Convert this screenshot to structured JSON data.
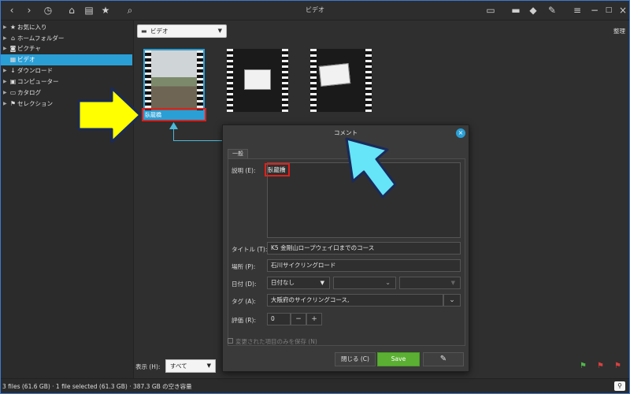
{
  "window": {
    "title": "ビデオ"
  },
  "sidebar": {
    "items": [
      {
        "label": "お気に入り",
        "icon": "star-icon",
        "selected": false
      },
      {
        "label": "ホームフォルダー",
        "icon": "home-icon",
        "selected": false
      },
      {
        "label": "ピクチャ",
        "icon": "camera-icon",
        "selected": false
      },
      {
        "label": "ビデオ",
        "icon": "film-icon",
        "selected": true
      },
      {
        "label": "ダウンロード",
        "icon": "download-icon",
        "selected": false
      },
      {
        "label": "コンピューター",
        "icon": "computer-icon",
        "selected": false
      },
      {
        "label": "カタログ",
        "icon": "catalog-icon",
        "selected": false
      },
      {
        "label": "セレクション",
        "icon": "flag-icon",
        "selected": false
      }
    ]
  },
  "toolbar": {
    "path": "ビデオ",
    "organize": "整理"
  },
  "thumbnails": [
    {
      "caption": "臥龍橋",
      "selected": true
    },
    {
      "caption": "",
      "selected": false
    },
    {
      "caption": "",
      "selected": false
    }
  ],
  "bottom": {
    "show_label": "表示 (H):",
    "show_value": "すべて"
  },
  "status": {
    "text": "3 files (61.6 GB)  ·  1 file selected (61.3 GB)  ·  387.3 GB の空き容量"
  },
  "dialog": {
    "title": "コメント",
    "tab": "一般",
    "description_label": "説明 (E):",
    "description_value": "臥龍橋",
    "title_label": "タイトル (T):",
    "title_value": "K5 金剛山ロープウェイ口までのコース",
    "place_label": "場所 (P):",
    "place_value": "石川サイクリングロード",
    "date_label": "日付 (D):",
    "date_value": "日付なし",
    "tag_label": "タグ (A):",
    "tag_value": "大阪府のサイクリングコース,",
    "rating_label": "評価 (R):",
    "rating_value": "0",
    "minus": "−",
    "plus": "+",
    "save_changed_only": "変更された項目のみを保存 (N)",
    "close_button": "閉じる (C)",
    "save_button": "Save"
  },
  "colors": {
    "accent": "#2a9fd6",
    "highlight_red": "#e0201b",
    "save_green": "#5bb033",
    "callout_yellow": "#ffff00",
    "callout_blue": "#66e4f8"
  }
}
